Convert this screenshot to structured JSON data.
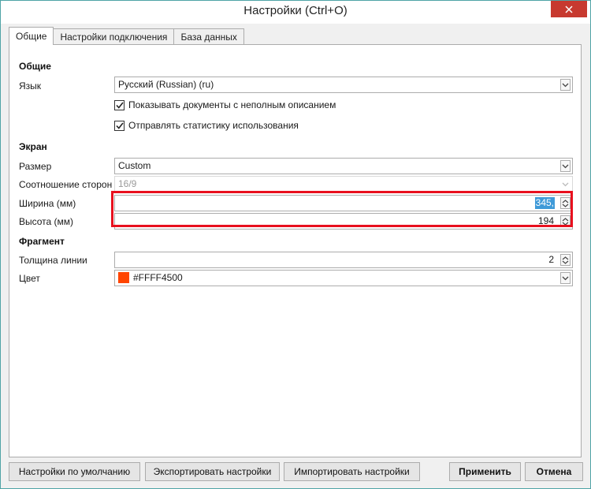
{
  "window": {
    "title": "Настройки (Ctrl+O)"
  },
  "tabs": [
    {
      "label": "Общие",
      "active": true
    },
    {
      "label": "Настройки подключения",
      "active": false
    },
    {
      "label": "База данных",
      "active": false
    }
  ],
  "general": {
    "header": "Общие",
    "language_label": "Язык",
    "language_value": "Русский (Russian) (ru)",
    "show_incomplete_docs": {
      "label": "Показывать документы с неполным описанием",
      "checked": true
    },
    "send_stats": {
      "label": "Отправлять статистику использования",
      "checked": true
    }
  },
  "screen": {
    "header": "Экран",
    "size_label": "Размер",
    "size_value": "Custom",
    "aspect_label": "Соотношение сторон",
    "aspect_value": "16/9",
    "width_label": "Ширина (мм)",
    "width_value": "345,",
    "height_label": "Высота (мм)",
    "height_value": "194"
  },
  "fragment": {
    "header": "Фрагмент",
    "line_width_label": "Толщина линии",
    "line_width_value": "2",
    "color_label": "Цвет",
    "color_value": "#FFFF4500",
    "color_swatch": "#ff4500"
  },
  "buttons": {
    "defaults": "Настройки по умолчанию",
    "export": "Экспортировать настройки",
    "import": "Импортировать настройки",
    "apply": "Применить",
    "cancel": "Отмена"
  },
  "colors": {
    "accent_border": "#4fa3a6",
    "close_button": "#c7392f",
    "highlight": "#e8101e",
    "selection": "#3f9ad8"
  }
}
